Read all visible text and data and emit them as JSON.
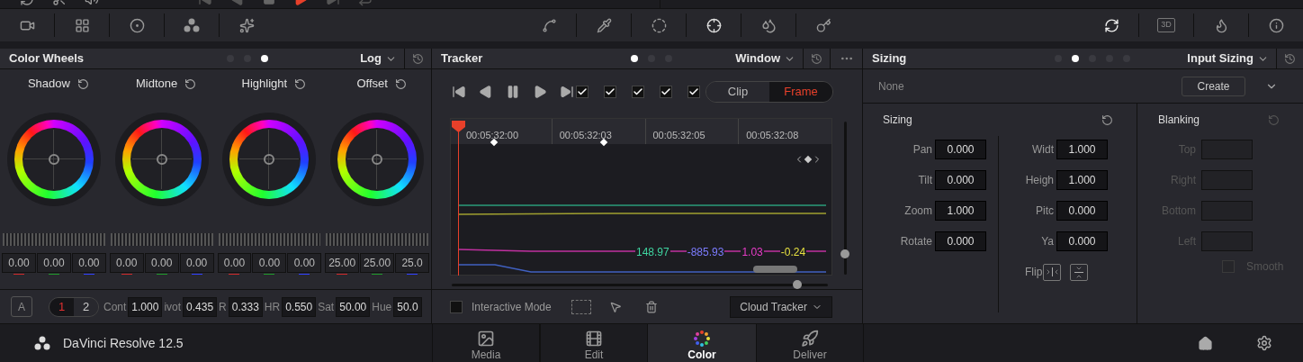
{
  "tracker_sliders": {
    "zoom": {
      "level": 0.11
    },
    "timeline": {
      "level": 0.93
    }
  },
  "toolbar": {
    "badge_3d": "3D"
  },
  "color_wheels": {
    "title": "Color Wheels",
    "page_dots": [
      {
        "selected": false
      },
      {
        "selected": false
      },
      {
        "selected": true
      }
    ],
    "mode": "Log",
    "wheels": [
      {
        "label": "Shadow",
        "values": [
          {
            "text": "0.00",
            "color": "#d02a2a"
          },
          {
            "text": "0.00",
            "color": "#1f9a2a"
          },
          {
            "text": "0.00",
            "color": "#3040ff"
          }
        ]
      },
      {
        "label": "Midtone",
        "values": [
          {
            "text": "0.00",
            "color": "#d02a2a"
          },
          {
            "text": "0.00",
            "color": "#1f9a2a"
          },
          {
            "text": "0.00",
            "color": "#3040ff"
          }
        ]
      },
      {
        "label": "Highlight",
        "values": [
          {
            "text": "0.00",
            "color": "#d02a2a"
          },
          {
            "text": "0.00",
            "color": "#1f9a2a"
          },
          {
            "text": "0.00",
            "color": "#3040ff"
          }
        ]
      },
      {
        "label": "Offset",
        "values": [
          {
            "text": "25.00",
            "color": "#d02a2a"
          },
          {
            "text": "25.00",
            "color": "#1f9a2a"
          },
          {
            "text": "25.0",
            "color": "#3040ff"
          }
        ]
      }
    ],
    "auto_button": "A",
    "pages": [
      {
        "label": "1",
        "selected": true
      },
      {
        "label": "2",
        "selected": false
      }
    ],
    "params": [
      {
        "label": "Cont",
        "value": "1.000"
      },
      {
        "label": "ivot",
        "value": "0.435"
      },
      {
        "label": "R",
        "value": "0.333"
      },
      {
        "label": "HR",
        "value": "0.550"
      },
      {
        "label": "Sat",
        "value": "50.00"
      },
      {
        "label": "Hue",
        "value": "50.0"
      }
    ]
  },
  "tracker": {
    "title": "Tracker",
    "page_dots": [
      {
        "selected": true
      },
      {
        "selected": false
      },
      {
        "selected": false
      }
    ],
    "mode": "Window",
    "checkboxes": [
      {
        "checked": true
      },
      {
        "checked": true
      },
      {
        "checked": true
      },
      {
        "checked": true
      },
      {
        "checked": true
      }
    ],
    "scope": [
      {
        "label": "Clip",
        "selected": false
      },
      {
        "label": "Frame",
        "selected": true
      }
    ],
    "timecodes": [
      "00:05:32:00",
      "00:05:32:03",
      "00:05:32:05",
      "00:05:32:08"
    ],
    "readouts": [
      {
        "text": "148.97",
        "color": "#3fd4a0"
      },
      {
        "text": "-885.93",
        "color": "#7c7cff"
      },
      {
        "text": "1.03",
        "color": "#e83cc8"
      },
      {
        "text": "-0.24",
        "color": "#e6e040"
      }
    ],
    "interactive_mode": {
      "label": "Interactive Mode",
      "checked": false
    },
    "tracker_type": "Cloud Tracker"
  },
  "sizing": {
    "title": "Sizing",
    "page_dots": [
      {
        "selected": false
      },
      {
        "selected": true
      },
      {
        "selected": false
      },
      {
        "selected": false
      },
      {
        "selected": false
      }
    ],
    "mode": "Input Sizing",
    "preset": "None",
    "create_button": "Create",
    "section_title": "Sizing",
    "left_fields": [
      {
        "label": "Pan",
        "value": "0.000"
      },
      {
        "label": "Tilt",
        "value": "0.000"
      },
      {
        "label": "Zoom",
        "value": "1.000"
      },
      {
        "label": "Rotate",
        "value": "0.000"
      }
    ],
    "right_fields": [
      {
        "label": "Widt",
        "value": "1.000"
      },
      {
        "label": "Heigh",
        "value": "1.000"
      },
      {
        "label": "Pitc",
        "value": "0.000"
      },
      {
        "label": "Ya",
        "value": "0.000"
      }
    ],
    "flip_label": "Flip",
    "blanking": {
      "title": "Blanking",
      "disabled": true,
      "fields": [
        "Top",
        "Right",
        "Bottom",
        "Left"
      ],
      "smooth": {
        "label": "Smooth",
        "checked": false
      }
    }
  },
  "bottom_bar": {
    "app_name": "DaVinci Resolve 12.5",
    "pages": [
      {
        "label": "Media",
        "selected": false
      },
      {
        "label": "Edit",
        "selected": false
      },
      {
        "label": "Color",
        "selected": true
      },
      {
        "label": "Deliver",
        "selected": false
      }
    ]
  }
}
